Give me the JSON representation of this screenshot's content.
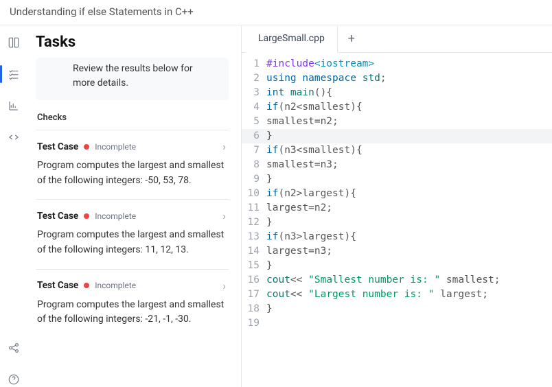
{
  "title": "Understanding if else Statements in C++",
  "rail": {
    "items": [
      "book",
      "checklist",
      "chart",
      "code"
    ],
    "bottom": [
      "share",
      "help"
    ],
    "activeIndex": 1
  },
  "panel": {
    "heading": "Tasks",
    "review": "Review the results below for more details.",
    "checksLabel": "Checks",
    "testCases": [
      {
        "title": "Test Case",
        "status": "Incomplete",
        "desc": "Program computes the largest and smallest of the following integers: -50, 53, 78."
      },
      {
        "title": "Test Case",
        "status": "Incomplete",
        "desc": "Program computes the largest and smallest of the following integers: 11, 12, 13."
      },
      {
        "title": "Test Case",
        "status": "Incomplete",
        "desc": "Program computes the largest and smallest of the following integers: -21, -1, -30."
      }
    ]
  },
  "editor": {
    "tabs": [
      {
        "label": "LargeSmall.cpp",
        "active": true
      }
    ],
    "code": [
      [
        {
          "t": "#include",
          "c": "pp"
        },
        {
          "t": "<iostream>",
          "c": "ns"
        }
      ],
      [
        {
          "t": "using ",
          "c": "kw"
        },
        {
          "t": "namespace ",
          "c": "kw"
        },
        {
          "t": "std",
          "c": "id"
        },
        {
          "t": ";",
          "c": "op"
        }
      ],
      [
        {
          "t": "int ",
          "c": "ty"
        },
        {
          "t": "main",
          "c": "id"
        },
        {
          "t": "(){",
          "c": "op"
        }
      ],
      [
        {
          "t": "if",
          "c": "kw"
        },
        {
          "t": "(n2<smallest){",
          "c": "op"
        }
      ],
      [
        {
          "t": "smallest=n2;",
          "c": "op"
        }
      ],
      [
        {
          "t": "}",
          "c": "op"
        }
      ],
      [
        {
          "t": "if",
          "c": "kw"
        },
        {
          "t": "(n3<smallest){",
          "c": "op"
        }
      ],
      [
        {
          "t": "smallest=n3;",
          "c": "op"
        }
      ],
      [
        {
          "t": "}",
          "c": "op"
        }
      ],
      [
        {
          "t": "if",
          "c": "kw"
        },
        {
          "t": "(n2>largest){",
          "c": "op"
        }
      ],
      [
        {
          "t": "largest=n2;",
          "c": "op"
        }
      ],
      [
        {
          "t": "}",
          "c": "op"
        }
      ],
      [
        {
          "t": "if",
          "c": "kw"
        },
        {
          "t": "(n3>largest){",
          "c": "op"
        }
      ],
      [
        {
          "t": "largest=n3;",
          "c": "op"
        }
      ],
      [
        {
          "t": "}",
          "c": "op"
        }
      ],
      [
        {
          "t": "cout",
          "c": "id"
        },
        {
          "t": "<< ",
          "c": "op"
        },
        {
          "t": "\"Smallest number is: \"",
          "c": "str"
        },
        {
          "t": " smallest;",
          "c": "op"
        }
      ],
      [
        {
          "t": "cout",
          "c": "id"
        },
        {
          "t": "<< ",
          "c": "op"
        },
        {
          "t": "\"Largest number is: \"",
          "c": "str"
        },
        {
          "t": " largest;",
          "c": "op"
        }
      ],
      [
        {
          "t": "}",
          "c": "op"
        }
      ],
      []
    ],
    "activeLine": 6
  }
}
